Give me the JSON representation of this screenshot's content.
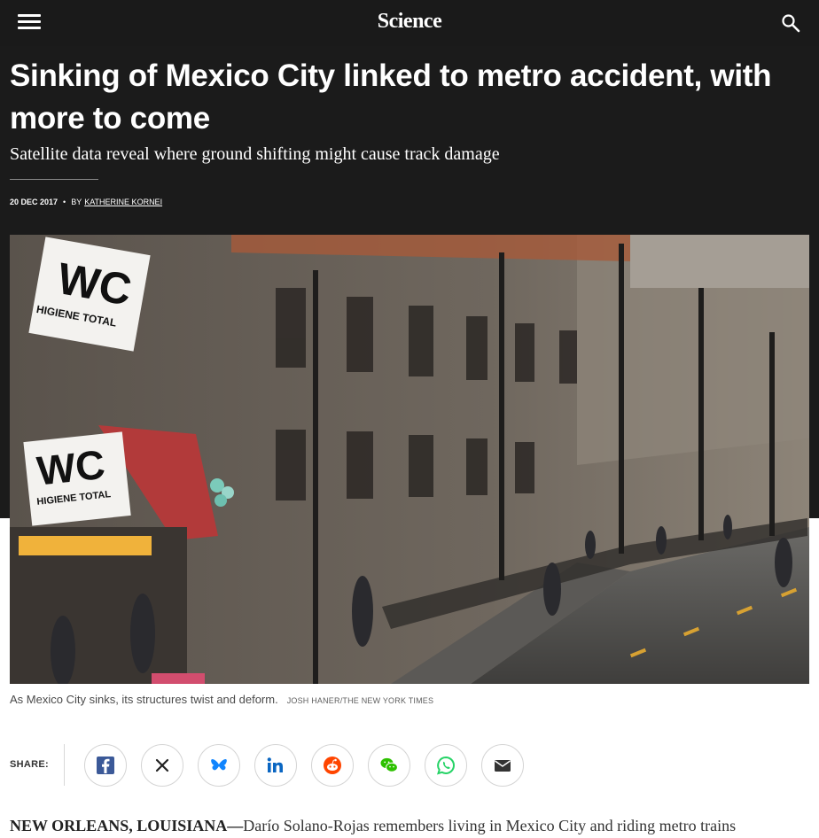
{
  "header": {
    "logo": "Science",
    "menu_icon": "hamburger-menu-icon",
    "search_icon": "search-icon"
  },
  "article": {
    "title": "Sinking of Mexico City linked to metro accident, with more to come",
    "subtitle": "Satellite data reveal where ground shifting might cause track damage",
    "date": "20 DEC 2017",
    "by_label": "BY",
    "author": "KATHERINE KORNEI"
  },
  "photo": {
    "sign_text_1": "WC",
    "sign_text_2": "HIGIENE TOTAL",
    "caption": "As Mexico City sinks, its structures twist and deform.",
    "credit": "JOSH HANER/THE NEW YORK TIMES"
  },
  "share": {
    "label": "SHARE:",
    "buttons": [
      {
        "icon": "facebook-icon",
        "color": "#3b5998"
      },
      {
        "icon": "x-icon",
        "color": "#222222"
      },
      {
        "icon": "bluesky-icon",
        "color": "#1185fe"
      },
      {
        "icon": "linkedin-icon",
        "color": "#0a66c2"
      },
      {
        "icon": "reddit-icon",
        "color": "#ff4500"
      },
      {
        "icon": "wechat-icon",
        "color": "#2dc100"
      },
      {
        "icon": "whatsapp-icon",
        "color": "#25d366"
      },
      {
        "icon": "email-icon",
        "color": "#333333"
      }
    ],
    "x_glyph": "𝕏"
  },
  "body": {
    "dateline": "NEW ORLEANS, LOUISIANA—",
    "text": "Darío Solano-Rojas remembers living in Mexico City and riding metro trains"
  },
  "colors": {
    "hero_bg": "#1b1b1b",
    "topbar_bg": "#1a1a1a",
    "text_white": "#ffffff",
    "body_text": "#333333"
  }
}
